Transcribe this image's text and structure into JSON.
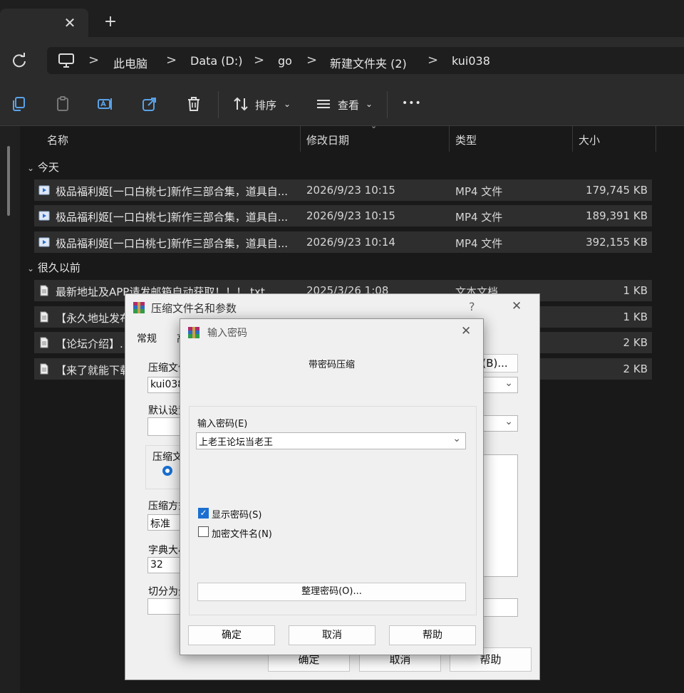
{
  "tabbar": {
    "close_glyph": "✕",
    "new_tab_glyph": "+"
  },
  "address": {
    "crumbs": [
      "此电脑",
      "Data (D:)",
      "go",
      "新建文件夹 (2)",
      "kui038"
    ],
    "separator": ">"
  },
  "toolbar": {
    "sort_label": "排序",
    "view_label": "查看",
    "more_label": "•••",
    "chevron": "⌄"
  },
  "columns": {
    "name": "名称",
    "date": "修改日期",
    "type": "类型",
    "size": "大小"
  },
  "groups": [
    {
      "label": "今天",
      "rows": [
        {
          "name": "极品福利姬[一口白桃七]新作三部合集，道具自...",
          "date": "2026/9/23 10:15",
          "type": "MP4 文件",
          "size": "179,745 KB"
        },
        {
          "name": "极品福利姬[一口白桃七]新作三部合集，道具自...",
          "date": "2026/9/23 10:15",
          "type": "MP4 文件",
          "size": "189,391 KB"
        },
        {
          "name": "极品福利姬[一口白桃七]新作三部合集，道具自...",
          "date": "2026/9/23 10:14",
          "type": "MP4 文件",
          "size": "392,155 KB"
        }
      ]
    },
    {
      "label": "很久以前",
      "rows": [
        {
          "name": "最新地址及APP请发邮箱自动获取！！！.txt",
          "date": "2025/3/26 1:08",
          "type": "文本文档",
          "size": "1 KB"
        },
        {
          "name": "【永久地址发布",
          "date": "",
          "type": "",
          "size": "1 KB"
        },
        {
          "name": "【论坛介绍】.",
          "date": "",
          "type": "",
          "size": "2 KB"
        },
        {
          "name": "【来了就能下载",
          "date": "",
          "type": "",
          "size": "2 KB"
        }
      ]
    }
  ],
  "archive_dialog": {
    "title": "压缩文件名和参数",
    "help_glyph": "?",
    "close_glyph": "✕",
    "tab_general": "常规",
    "tab_next": "高",
    "archive_name_label": "压缩文件",
    "archive_name_value": "kui038",
    "browse_button": "(B)...",
    "default_settings_label": "默认设置",
    "format_label": "压缩文",
    "method_label": "压缩方式",
    "method_value": "标准",
    "dict_label": "字典大小",
    "dict_value": "32",
    "split_label": "切分为分",
    "ok": "确定",
    "cancel": "取消",
    "help": "帮助"
  },
  "password_dialog": {
    "title": "输入密码",
    "close_glyph": "✕",
    "heading": "带密码压缩",
    "password_label": "输入密码(E)",
    "password_value": "上老王论坛当老王",
    "show_password_label": "显示密码(S)",
    "show_password_checked": true,
    "encrypt_names_label": "加密文件名(N)",
    "encrypt_names_checked": false,
    "organize_button": "整理密码(O)...",
    "ok": "确定",
    "cancel": "取消",
    "help": "帮助"
  }
}
